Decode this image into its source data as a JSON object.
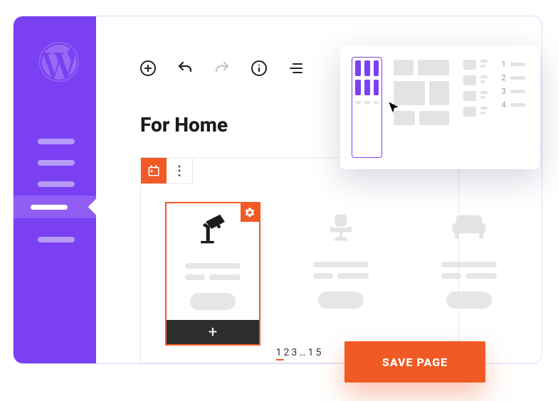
{
  "page": {
    "title": "For Home"
  },
  "toolbar": {
    "add": "add",
    "undo": "undo",
    "redo": "redo",
    "info": "info",
    "list": "list"
  },
  "block": {
    "active_tab_icon": "calendar-icon",
    "cards": [
      {
        "icon": "lamp-icon",
        "selected": true
      },
      {
        "icon": "office-chair-icon",
        "selected": false
      },
      {
        "icon": "sofa-icon",
        "selected": false
      }
    ],
    "add_label": "+",
    "more_label": "⋮"
  },
  "pagination": {
    "current": "1",
    "p2": "2",
    "p3": "3",
    "ellipsis": "…",
    "last": "15"
  },
  "layout_popover": {
    "options": [
      "grid-3x2",
      "masonry",
      "list-rows",
      "numbered-list"
    ],
    "numbered": {
      "n1": "1",
      "n2": "2",
      "n3": "3",
      "n4": "4"
    }
  },
  "actions": {
    "save": "SAVE PAGE"
  },
  "colors": {
    "brand": "#7a40f2",
    "accent": "#f15a24",
    "muted": "#e6e6e6"
  }
}
